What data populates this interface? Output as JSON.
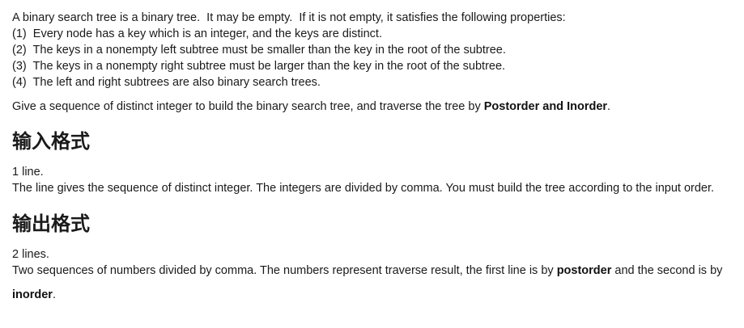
{
  "intro": {
    "line0": "A binary search tree is a binary tree.  It may be empty.  If it is not empty, it satisfies the following properties:",
    "props": [
      "(1)  Every node has a key which is an integer, and the keys are distinct.",
      "(2)  The keys in a nonempty left subtree must be smaller than the key in the root of the subtree.",
      "(3)  The keys in a nonempty right subtree must be larger than the key in the root of the subtree.",
      "(4)  The left and right subtrees are also binary search trees."
    ],
    "task_prefix": "Give a sequence of distinct integer to build the binary search tree, and traverse the tree by ",
    "task_bold": "Postorder and Inorder",
    "task_suffix": "."
  },
  "input_section": {
    "heading": "输入格式",
    "line1": "1 line.",
    "line2": "The line gives the sequence of distinct integer. The integers are divided by comma. You must build the tree according to the input order."
  },
  "output_section": {
    "heading": "输出格式",
    "line1": "2 lines.",
    "line2_prefix": "Two sequences of numbers divided by comma. The numbers represent traverse result, the first line is by ",
    "line2_bold": "postorder",
    "line2_suffix": " and the second is by",
    "line3_bold": "inorder",
    "line3_suffix": "."
  }
}
